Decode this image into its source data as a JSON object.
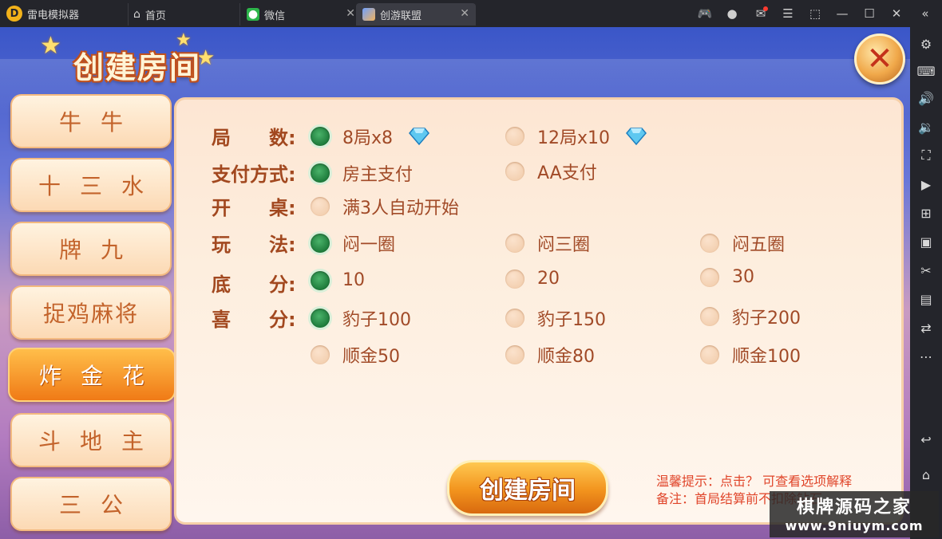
{
  "emulator": {
    "app_name": "雷电模拟器",
    "tabs": [
      {
        "label": "首页"
      },
      {
        "label": "微信"
      },
      {
        "label": "创游联盟"
      }
    ],
    "colors": {
      "chrome_bg": "#24252b",
      "logo": "#f2b21a",
      "notification": "#ff3b30"
    }
  },
  "game": {
    "title": "创建房间",
    "categories": [
      {
        "label": "牛牛",
        "active": false
      },
      {
        "label": "十三水",
        "active": false
      },
      {
        "label": "牌九",
        "active": false
      },
      {
        "label": "捉鸡麻将",
        "active": false
      },
      {
        "label": "炸金花",
        "active": true
      },
      {
        "label": "斗地主",
        "active": false
      },
      {
        "label": "三公",
        "active": false
      }
    ],
    "labels": {
      "rounds": "局　　数:",
      "payment": "支付方式:",
      "start": "开　　桌:",
      "play": "玩　　法:",
      "base": "底　　分:",
      "bonus": "喜　　分:"
    },
    "options": {
      "rounds": [
        {
          "label": "8局x8",
          "selected": true
        },
        {
          "label": "12局x10",
          "selected": false
        }
      ],
      "payment": [
        {
          "label": "房主支付",
          "selected": true
        },
        {
          "label": "AA支付",
          "selected": false
        }
      ],
      "start": [
        {
          "label": "满3人自动开始",
          "selected": false
        }
      ],
      "play": [
        {
          "label": "闷一圈",
          "selected": true
        },
        {
          "label": "闷三圈",
          "selected": false
        },
        {
          "label": "闷五圈",
          "selected": false
        }
      ],
      "base": [
        {
          "label": "10",
          "selected": true
        },
        {
          "label": "20",
          "selected": false
        },
        {
          "label": "30",
          "selected": false
        }
      ],
      "bonus_row1": [
        {
          "label": "豹子100",
          "selected": true
        },
        {
          "label": "豹子150",
          "selected": false
        },
        {
          "label": "豹子200",
          "selected": false
        }
      ],
      "bonus_row2": [
        {
          "label": "顺金50",
          "selected": false
        },
        {
          "label": "顺金80",
          "selected": false
        },
        {
          "label": "顺金100",
          "selected": false
        }
      ]
    },
    "create_button": "创建房间",
    "tip1": "温馨提示：点击？ 可查看选项解释",
    "tip2": "备注：首局结算前不扣除钻石",
    "watermark_line1": "棋牌源码之家",
    "watermark_line2": "www.9niuym.com",
    "colors": {
      "selected_radio": "#1d7a3a",
      "label": "#a2481f",
      "accent_orange": "#f2931d",
      "tip": "#e0452a"
    }
  }
}
